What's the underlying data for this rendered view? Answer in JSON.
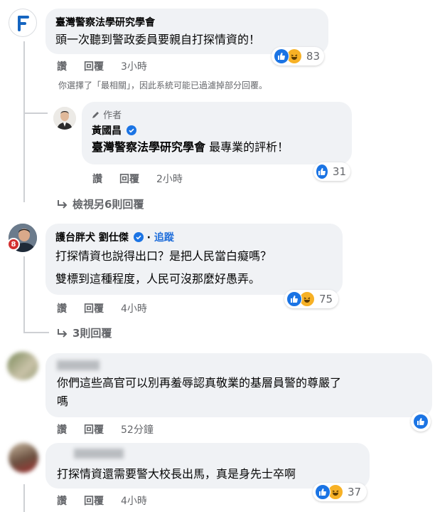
{
  "comments": [
    {
      "author": "臺灣警察法學研究學會",
      "text": "頭一次聽到警政委員要親自打探情資的！",
      "reactions": {
        "icons": [
          "like-icon",
          "haha-icon"
        ],
        "count": "83"
      },
      "actions": {
        "like": "讚",
        "reply": "回覆",
        "time": "3小時"
      }
    },
    {
      "role_badge": "作者",
      "author": "黃國昌",
      "verified": true,
      "text_mention": "臺灣警察法學研究學會",
      "text_rest": " 最專業的評析！",
      "reactions": {
        "icons": [
          "like-icon"
        ],
        "count": "31"
      },
      "actions": {
        "like": "讚",
        "reply": "回覆",
        "time": "2小時"
      }
    },
    {
      "author": "護台胖犬 劉仕傑",
      "verified": true,
      "follow": "追蹤",
      "avatar_badge": "8",
      "text_lines": [
        "打探情資也說得出口？是把人民當白癡嗎？",
        "雙標到這種程度，人民可沒那麼好愚弄。"
      ],
      "reactions": {
        "icons": [
          "like-icon",
          "haha-icon"
        ],
        "count": "75"
      },
      "actions": {
        "like": "讚",
        "reply": "回覆",
        "time": "4小時"
      }
    },
    {
      "author": "",
      "text_lines": [
        "你們這些高官可以別再羞辱認真敬業的基層員警的尊嚴了",
        "嗎"
      ],
      "reactions": {
        "icons": [
          "like-icon"
        ],
        "count": ""
      },
      "actions": {
        "like": "讚",
        "reply": "回覆",
        "time": "52分鐘"
      }
    },
    {
      "author": "",
      "text": "打探情資還需要警大校長出馬，真是身先士卒啊",
      "reactions": {
        "icons": [
          "like-icon",
          "haha-icon"
        ],
        "count": "37"
      },
      "actions": {
        "like": "讚",
        "reply": "回覆",
        "time": "4小時"
      }
    }
  ],
  "filter_notice": "你選擇了「最相關」，因此系統可能已過濾掉部分回覆。",
  "view_more_replies": "檢視另6則回覆",
  "more_replies": "3則回覆",
  "colors": {
    "like_blue": "#1b74e4",
    "haha_yellow": "#f7b125",
    "bubble": "#f0f2f5",
    "meta_gray": "#65676b",
    "follow_blue": "#216fdb"
  }
}
